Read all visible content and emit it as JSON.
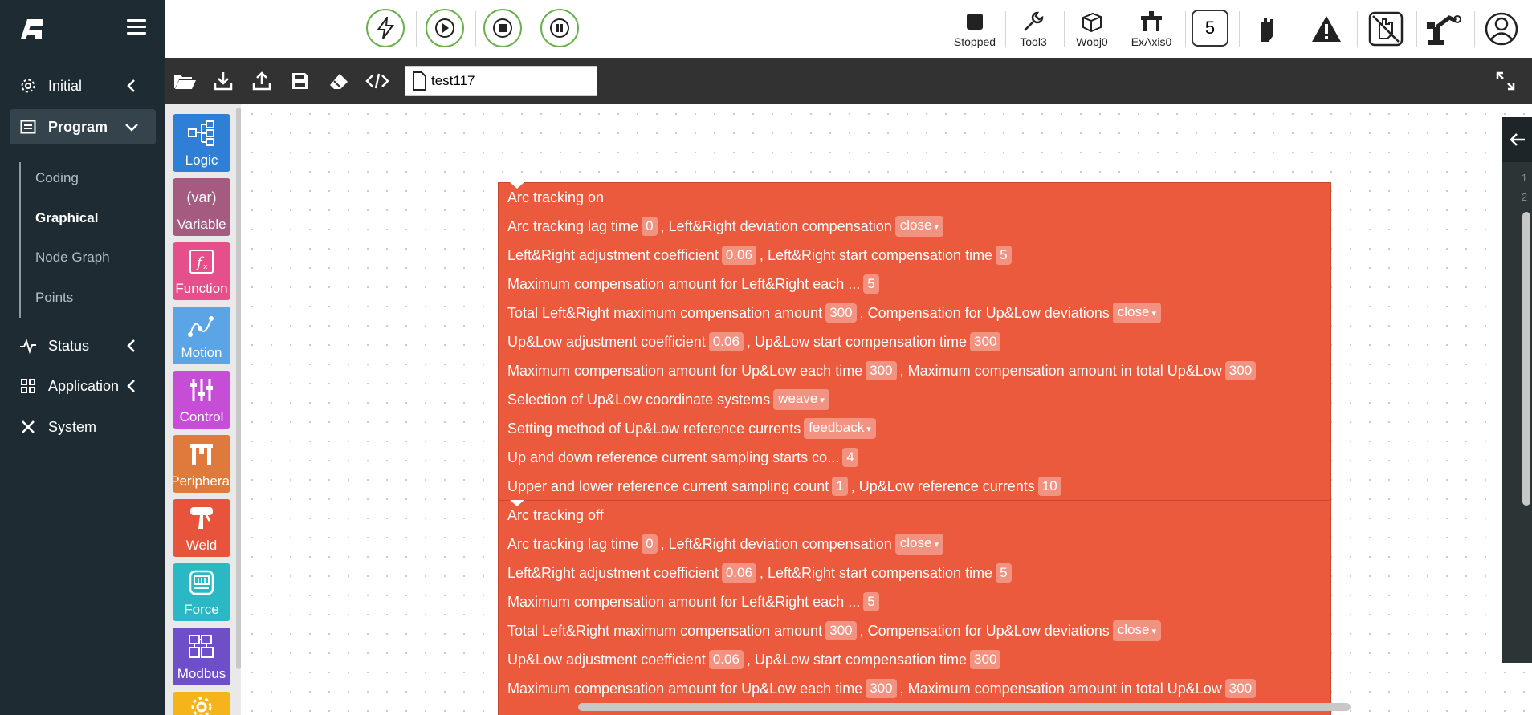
{
  "sidebar": {
    "nav": [
      {
        "label": "Initial"
      },
      {
        "label": "Program"
      },
      {
        "label": "Status"
      },
      {
        "label": "Application"
      },
      {
        "label": "System"
      }
    ],
    "sub": [
      {
        "label": "Coding"
      },
      {
        "label": "Graphical"
      },
      {
        "label": "Node Graph"
      },
      {
        "label": "Points"
      }
    ]
  },
  "topbar": {
    "status": [
      {
        "label": "Stopped",
        "icon": "stop-square-icon"
      },
      {
        "label": "Tool3",
        "icon": "wrench-icon"
      },
      {
        "label": "Wobj0",
        "icon": "cube-icon"
      },
      {
        "label": "ExAxis0",
        "icon": "ext-axis-icon"
      }
    ],
    "speed": "5"
  },
  "toolbar": {
    "filename": "test117"
  },
  "toolbox": [
    {
      "label": "Logic",
      "color": "#2f7fd7",
      "icon": "logic-icon"
    },
    {
      "label": "Variable",
      "color": "#a55b80",
      "icon": "var-icon"
    },
    {
      "label": "Function",
      "color": "#e6508a",
      "icon": "function-icon"
    },
    {
      "label": "Motion",
      "color": "#5ba5e6",
      "icon": "motion-icon"
    },
    {
      "label": "Control",
      "color": "#c64ed6",
      "icon": "control-icon"
    },
    {
      "label": "Peripheral",
      "color": "#e07a3c",
      "icon": "peripheral-icon"
    },
    {
      "label": "Weld",
      "color": "#e8543b",
      "icon": "weld-icon"
    },
    {
      "label": "Force",
      "color": "#2ab8c4",
      "icon": "force-icon"
    },
    {
      "label": "Modbus",
      "color": "#6f4ec9",
      "icon": "modbus-icon"
    }
  ],
  "block_on": {
    "title": "Arc tracking on",
    "lag_label": "Arc tracking lag time",
    "lag": "0",
    "lr_dev_label": "Left&Right deviation compensation",
    "lr_dev": "close",
    "lr_coef_label": "Left&Right adjustment coefficient",
    "lr_coef": "0.06",
    "lr_start_label": "Left&Right start compensation time",
    "lr_start": "5",
    "lr_max_each_label": "Maximum compensation amount for Left&Right each ...",
    "lr_max_each": "5",
    "lr_total_label": "Total Left&Right maximum compensation amount",
    "lr_total": "300",
    "ul_dev_label": "Compensation for Up&Low deviations",
    "ul_dev": "close",
    "ul_coef_label": "Up&Low adjustment coefficient",
    "ul_coef": "0.06",
    "ul_start_label": "Up&Low start compensation time",
    "ul_start": "300",
    "ul_max_each_label": "Maximum compensation amount for Up&Low each time",
    "ul_max_each": "300",
    "ul_total_label": "Maximum compensation amount in total Up&Low",
    "ul_total": "300",
    "coord_label": "Selection of Up&Low coordinate systems",
    "coord": "weave",
    "method_label": "Setting method of Up&Low reference currents",
    "method": "feedback",
    "sample_start_label": "Up and down reference current sampling starts co...",
    "sample_start": "4",
    "sample_count_label": "Upper and lower reference current sampling count",
    "sample_count": "1",
    "ref_label": "Up&Low reference currents",
    "ref": "10"
  },
  "block_off": {
    "title": "Arc tracking off",
    "lag_label": "Arc tracking lag time",
    "lag": "0",
    "lr_dev_label": "Left&Right deviation compensation",
    "lr_dev": "close",
    "lr_coef_label": "Left&Right adjustment coefficient",
    "lr_coef": "0.06",
    "lr_start_label": "Left&Right start compensation time",
    "lr_start": "5",
    "lr_max_each_label": "Maximum compensation amount for Left&Right each ...",
    "lr_max_each": "5",
    "lr_total_label": "Total Left&Right maximum compensation amount",
    "lr_total": "300",
    "ul_dev_label": "Compensation for Up&Low deviations",
    "ul_dev": "close",
    "ul_coef_label": "Up&Low adjustment coefficient",
    "ul_coef": "0.06",
    "ul_start_label": "Up&Low start compensation time",
    "ul_start": "300",
    "ul_max_each_label": "Maximum compensation amount for Up&Low each time",
    "ul_max_each": "300",
    "ul_total_label": "Maximum compensation amount in total Up&Low",
    "ul_total": "300"
  },
  "code_panel": {
    "lines": [
      "1",
      "2"
    ]
  }
}
